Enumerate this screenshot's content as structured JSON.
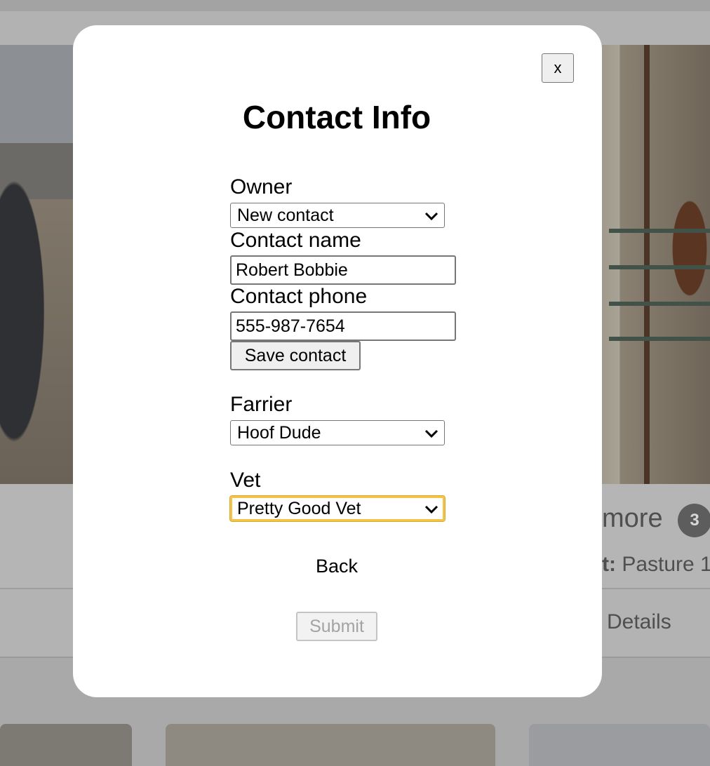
{
  "background": {
    "more_label": "more",
    "more_count": "3",
    "location_label": "t:",
    "location_value": "Pasture 1",
    "details_tab": "Details"
  },
  "modal": {
    "close_label": "x",
    "title": "Contact Info",
    "owner": {
      "label": "Owner",
      "selected": "New contact"
    },
    "contact_name": {
      "label": "Contact name",
      "value": "Robert Bobbie"
    },
    "contact_phone": {
      "label": "Contact phone",
      "value": "555-987-7654"
    },
    "save_contact_label": "Save contact",
    "farrier": {
      "label": "Farrier",
      "selected": "Hoof Dude"
    },
    "vet": {
      "label": "Vet",
      "selected": "Pretty Good Vet"
    },
    "back_label": "Back",
    "submit_label": "Submit"
  },
  "colors": {
    "overlay": "#a9a9a9",
    "focus_ring": "#f2c54a",
    "badge": "#5d5d5d"
  }
}
